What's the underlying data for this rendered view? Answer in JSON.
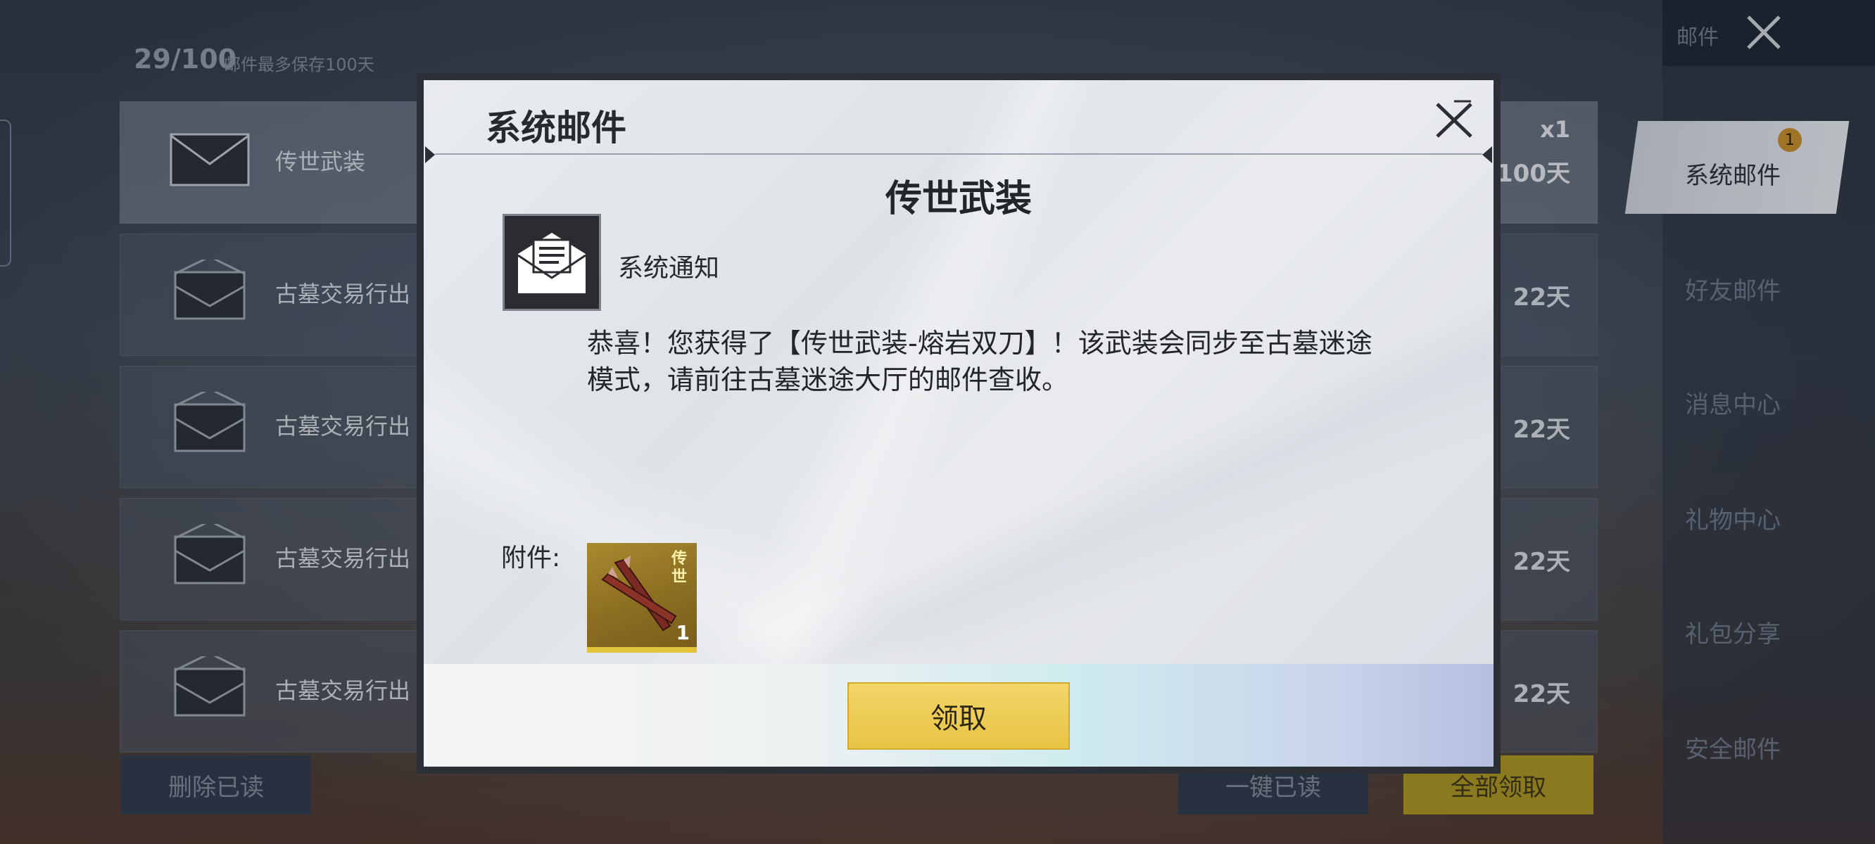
{
  "mailbox": {
    "counter": "29/100",
    "counter_hint": "邮件最多保存100天",
    "rows": [
      {
        "title": "传世武装",
        "right_top": "x1",
        "right_bottom": "100天"
      },
      {
        "title": "古墓交易行出",
        "right": "22天"
      },
      {
        "title": "古墓交易行出",
        "right": "22天"
      },
      {
        "title": "古墓交易行出",
        "right": "22天"
      },
      {
        "title": "古墓交易行出",
        "right": "22天"
      }
    ],
    "buttons": {
      "delete_read": "删除已读",
      "mark_all_read": "一键已读",
      "claim_all": "全部领取"
    }
  },
  "nav": {
    "header_label": "邮件",
    "badge": "1",
    "items": [
      {
        "label": "系统邮件"
      },
      {
        "label": "好友邮件"
      },
      {
        "label": "消息中心"
      },
      {
        "label": "礼物中心"
      },
      {
        "label": "礼包分享"
      },
      {
        "label": "安全邮件"
      }
    ]
  },
  "modal": {
    "header_title": "系统邮件",
    "mail_title": "传世武装",
    "sender": "系统通知",
    "body_line1": "恭喜！您获得了【传世武装-熔岩双刀】！该武装会同步至古墓迷途",
    "body_line2": "模式，请前往古墓迷途大厅的邮件查收。",
    "attachment_label": "附件:",
    "attachment": {
      "tag": "传世",
      "quantity": "1"
    },
    "claim_button": "领取"
  },
  "colors": {
    "claim_button": "#e8c445",
    "modal_frame": "#2c2f36",
    "nav_bg": "#1f2733"
  }
}
